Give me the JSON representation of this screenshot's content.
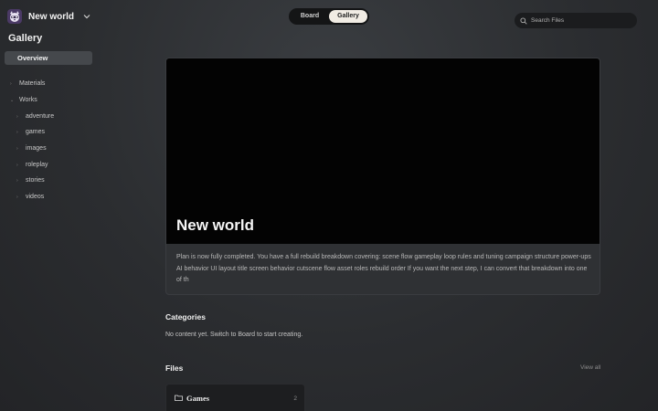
{
  "workspace": {
    "name": "New world",
    "logo_icon": "raccoon-avatar-icon"
  },
  "sidebar": {
    "title": "Gallery",
    "overview_label": "Overview",
    "items": [
      {
        "label": "Materials"
      },
      {
        "label": "Works"
      },
      {
        "label": "adventure"
      },
      {
        "label": "games"
      },
      {
        "label": "images"
      },
      {
        "label": "roleplay"
      },
      {
        "label": "stories"
      },
      {
        "label": "videos"
      }
    ]
  },
  "view_toggle": {
    "board": "Board",
    "gallery": "Gallery",
    "active": "Gallery"
  },
  "search": {
    "placeholder": "Search Files"
  },
  "hero": {
    "title": "New world",
    "description": "Plan is now fully completed. You have a full rebuild breakdown covering: scene flow gameplay loop rules and tuning campaign structure power-ups AI behavior UI layout title screen behavior cutscene flow asset roles rebuild order If you want the next step, I can convert that breakdown into one of th"
  },
  "categories": {
    "title": "Categories",
    "empty_text": "No content yet. Switch to Board to start creating."
  },
  "files": {
    "title": "Files",
    "view_all": "View all",
    "items": [
      {
        "name": "Games",
        "count": "2",
        "icon": "folder-icon"
      }
    ]
  },
  "colors": {
    "accent_toggle": "#f1ece4",
    "hero_bg": "#030303",
    "logo_bg": "#4b3a66"
  }
}
